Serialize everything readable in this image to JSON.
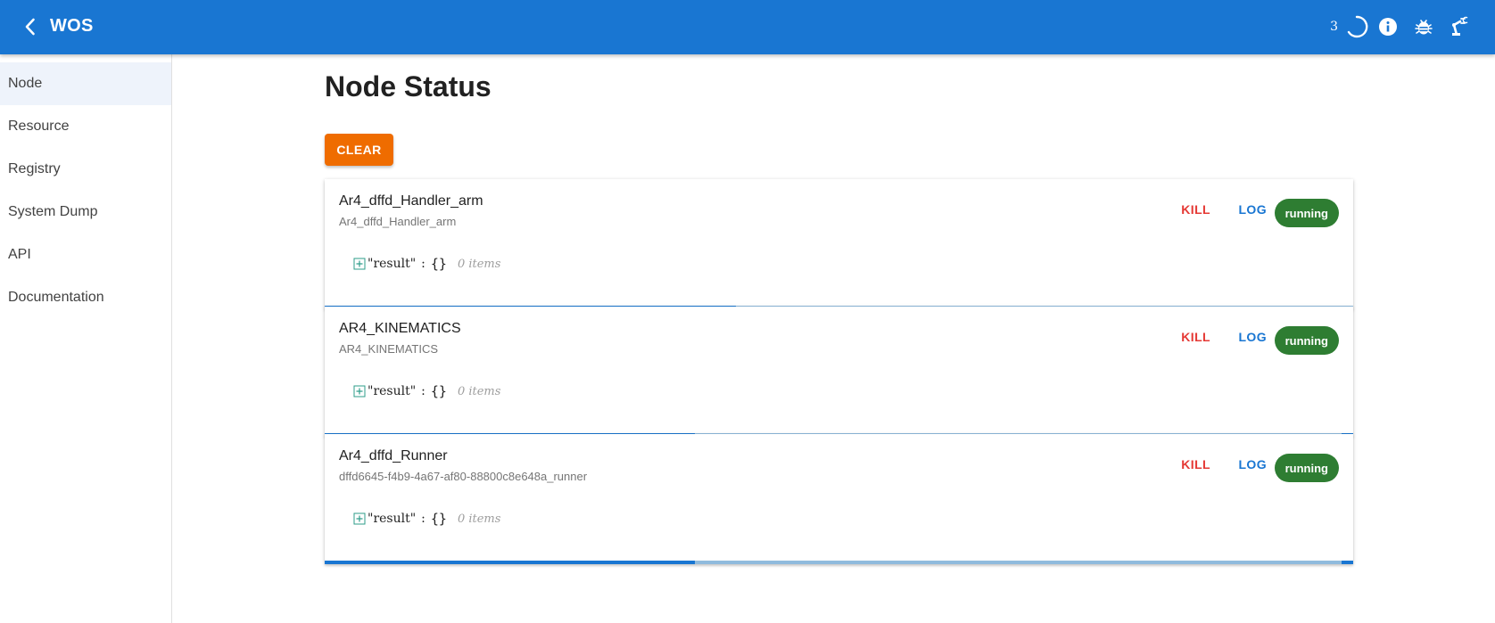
{
  "app": {
    "title": "WOS",
    "task_count": "3"
  },
  "icons": {
    "back": "chevron-left-icon",
    "loading": "loading-spinner-icon",
    "info": "info-icon",
    "debug": "bug-icon",
    "robot": "robot-arm-icon"
  },
  "colors": {
    "appbar": "#1976d2",
    "clear_button": "#ef6c00",
    "kill": "#e53935",
    "log": "#1976d2",
    "running": "#2e7d32"
  },
  "sidebar": {
    "items": [
      {
        "label": "Node",
        "active": true
      },
      {
        "label": "Resource"
      },
      {
        "label": "Registry"
      },
      {
        "label": "System Dump"
      },
      {
        "label": "API"
      },
      {
        "label": "Documentation"
      }
    ]
  },
  "main": {
    "title": "Node Status",
    "clear_label": "CLEAR",
    "kill_label": "KILL",
    "log_label": "LOG",
    "nodes": [
      {
        "name": "Ar4_dffd_Handler_arm",
        "id": "Ar4_dffd_Handler_arm",
        "status": "running",
        "json_key": "\"result\"",
        "json_colon": ":",
        "json_value": "{}",
        "json_count": "0 items",
        "progress": 0.4
      },
      {
        "name": "AR4_KINEMATICS",
        "id": "AR4_KINEMATICS",
        "status": "running",
        "json_key": "\"result\"",
        "json_colon": ":",
        "json_value": "{}",
        "json_count": "0 items",
        "progress": 0.36
      },
      {
        "name": "Ar4_dffd_Runner",
        "id": "dffd6645-f4b9-4a67-af80-88800c8e648a_runner",
        "status": "running",
        "json_key": "\"result\"",
        "json_colon": ":",
        "json_value": "{}",
        "json_count": "0 items",
        "progress": 0.36
      }
    ]
  }
}
